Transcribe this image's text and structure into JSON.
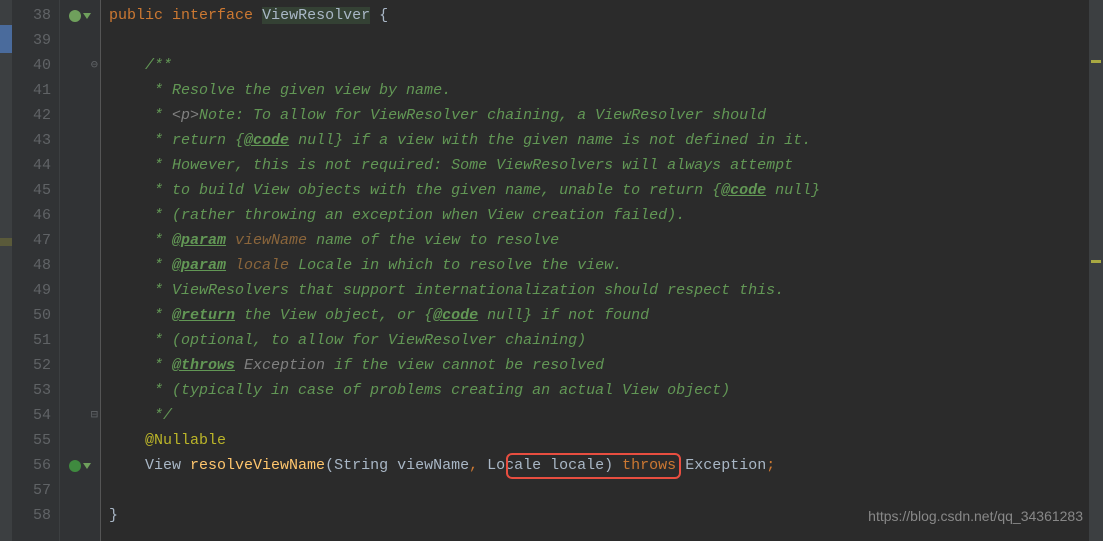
{
  "watermark": "https://blog.csdn.net/qq_34361283",
  "gutter": {
    "start": 38,
    "end": 58
  },
  "code": {
    "line38": {
      "kw_public": "public",
      "kw_interface": "interface",
      "name": "ViewResolver",
      "brace": " {"
    },
    "doc": {
      "open": "/**",
      "l41": " * Resolve the given view by name.",
      "l42_a": " * ",
      "l42_b": "<p>",
      "l42_c": "Note: To allow for ViewResolver chaining, a ViewResolver should",
      "l43_a": " * return {",
      "l43_tag": "@code",
      "l43_b": " null} if a view with the given name is not defined in it.",
      "l44": " * However, this is not required: Some ViewResolvers will always attempt",
      "l45_a": " * to build View objects with the given name, unable to return {",
      "l45_tag": "@code",
      "l45_b": " null}",
      "l46": " * (rather throwing an exception when View creation failed).",
      "l47_a": " * ",
      "l47_tag": "@param",
      "l47_param": " viewName",
      "l47_b": " name of the view to resolve",
      "l48_a": " * ",
      "l48_tag": "@param",
      "l48_param": " locale",
      "l48_b": " Locale in which to resolve the view.",
      "l49": " * ViewResolvers that support internationalization should respect this.",
      "l50_a": " * ",
      "l50_tag": "@return",
      "l50_b": " the View object, or {",
      "l50_tag2": "@code",
      "l50_c": " null} if not found",
      "l51": " * (optional, to allow for ViewResolver chaining)",
      "l52_a": " * ",
      "l52_tag": "@throws",
      "l52_b": " Exception",
      "l52_c": " if the view cannot be resolved",
      "l53": " * (typically in case of problems creating an actual View object)",
      "close": " */"
    },
    "l55_annotation": "@Nullable",
    "l56": {
      "type": "View ",
      "method": "resolveViewName",
      "paren_open": "(",
      "p1_type": "String ",
      "p1_name": "viewName",
      "comma": ",",
      "p2": " Locale locale",
      "paren_close": ") ",
      "throws": "throws",
      "exc": " Exception",
      "semi": ";"
    },
    "l58_brace": "}"
  },
  "indent1": "    ",
  "indent2": "        "
}
